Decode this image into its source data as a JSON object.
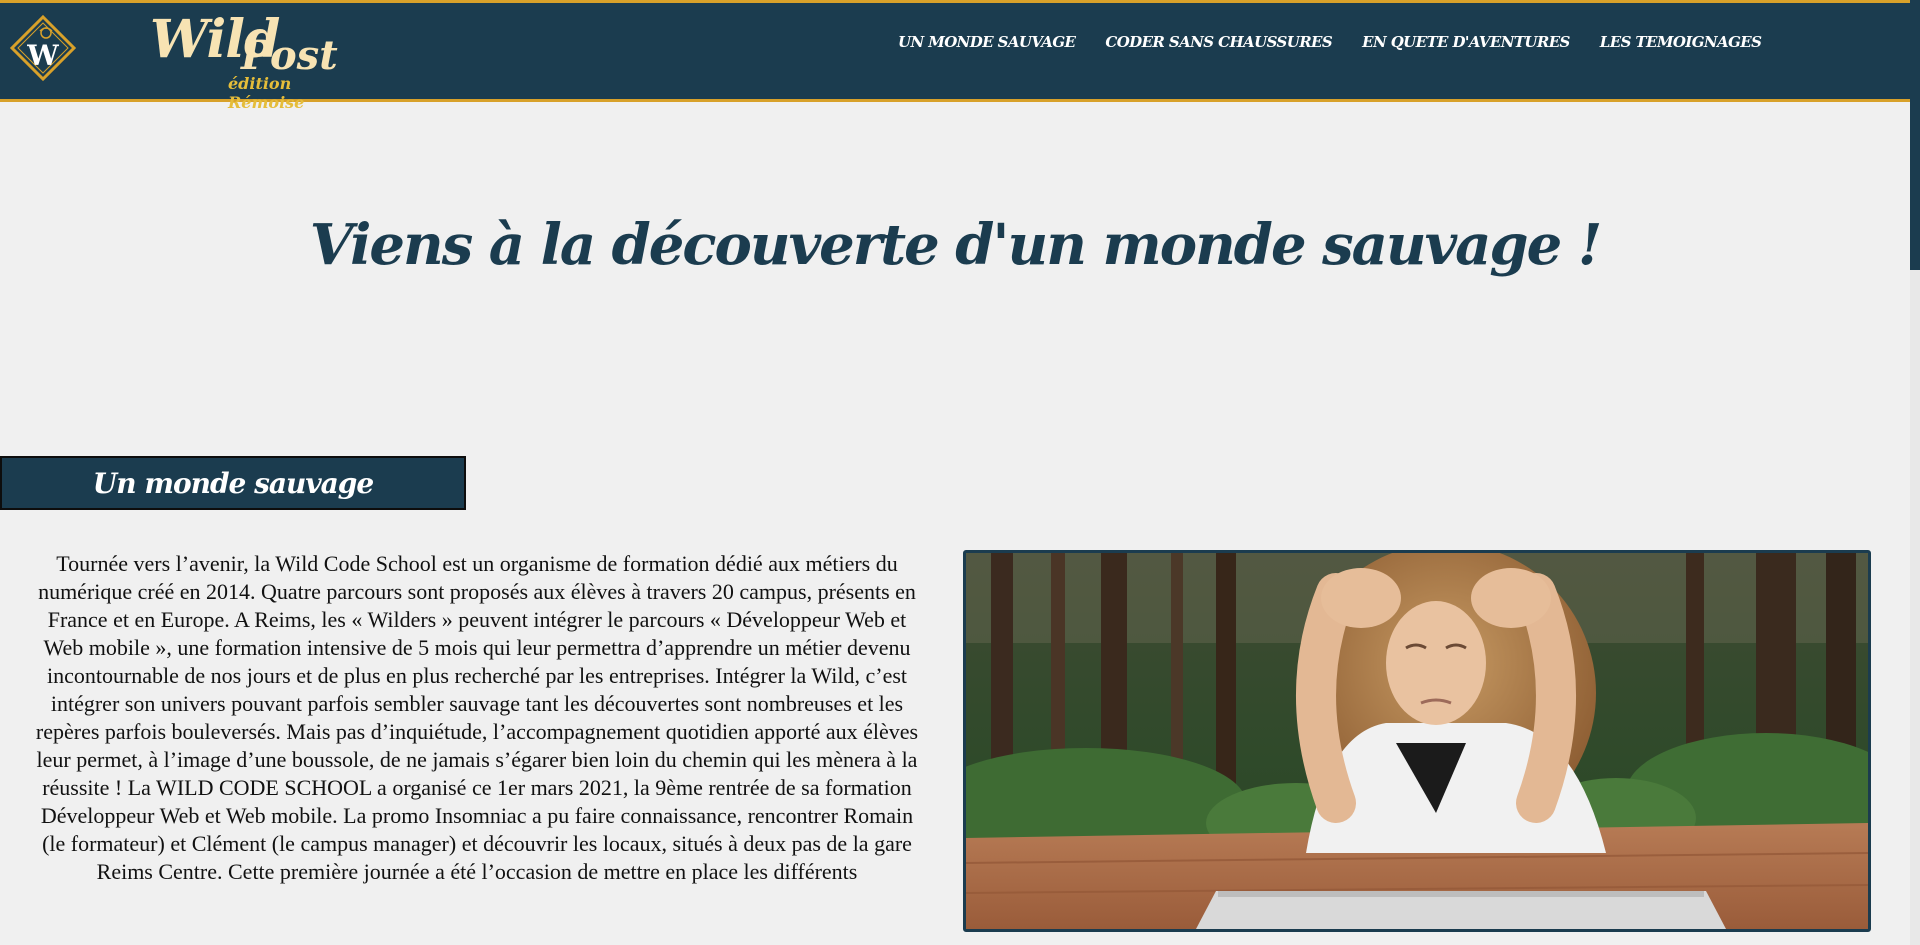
{
  "header": {
    "logo_badge_letter": "W",
    "logo_wild": "Wild",
    "logo_post": "Post",
    "logo_edition": "édition Rémoise",
    "nav": [
      {
        "label": "UN MONDE SAUVAGE"
      },
      {
        "label": "CODER SANS CHAUSSURES"
      },
      {
        "label": "EN QUETE D'AVENTURES"
      },
      {
        "label": "LES TEMOIGNAGES"
      }
    ]
  },
  "hero": {
    "title": "Viens à la découverte d'un monde sauvage !"
  },
  "section": {
    "heading": "Un monde sauvage",
    "text": "Tournée vers l’avenir, la Wild Code School est un organisme de formation dédié aux métiers du numérique créé en 2014. Quatre parcours sont proposés aux élèves à travers 20 campus, présents en France et en Europe. A Reims, les « Wilders » peuvent intégrer le parcours « Développeur Web et Web mobile », une formation intensive de 5 mois qui leur permettra d’apprendre un métier devenu incontournable de nos jours et de plus en plus recherché par les entreprises. Intégrer la Wild, c’est intégrer son univers pouvant parfois sembler sauvage tant les découvertes sont nombreuses et les repères parfois bouleversés. Mais pas d’inquiétude, l’accompagnement quotidien apporté aux élèves leur permet, à l’image d’une boussole, de ne jamais s’égarer bien loin du chemin qui les mènera à la réussite ! La WILD CODE SCHOOL a organisé ce 1er mars 2021, la 9ème rentrée de sa formation Développeur Web et Web mobile. La promo Insomniac a pu faire connaissance, rencontrer Romain (le formateur) et Clément (le campus manager) et découvrir les locaux, situés à deux pas de la gare Reims Centre. Cette première journée a été l’occasion de mettre en place les différents"
  },
  "colors": {
    "primary": "#1b3c4f",
    "gold": "#d8a12a",
    "background": "#f0f0f0"
  }
}
